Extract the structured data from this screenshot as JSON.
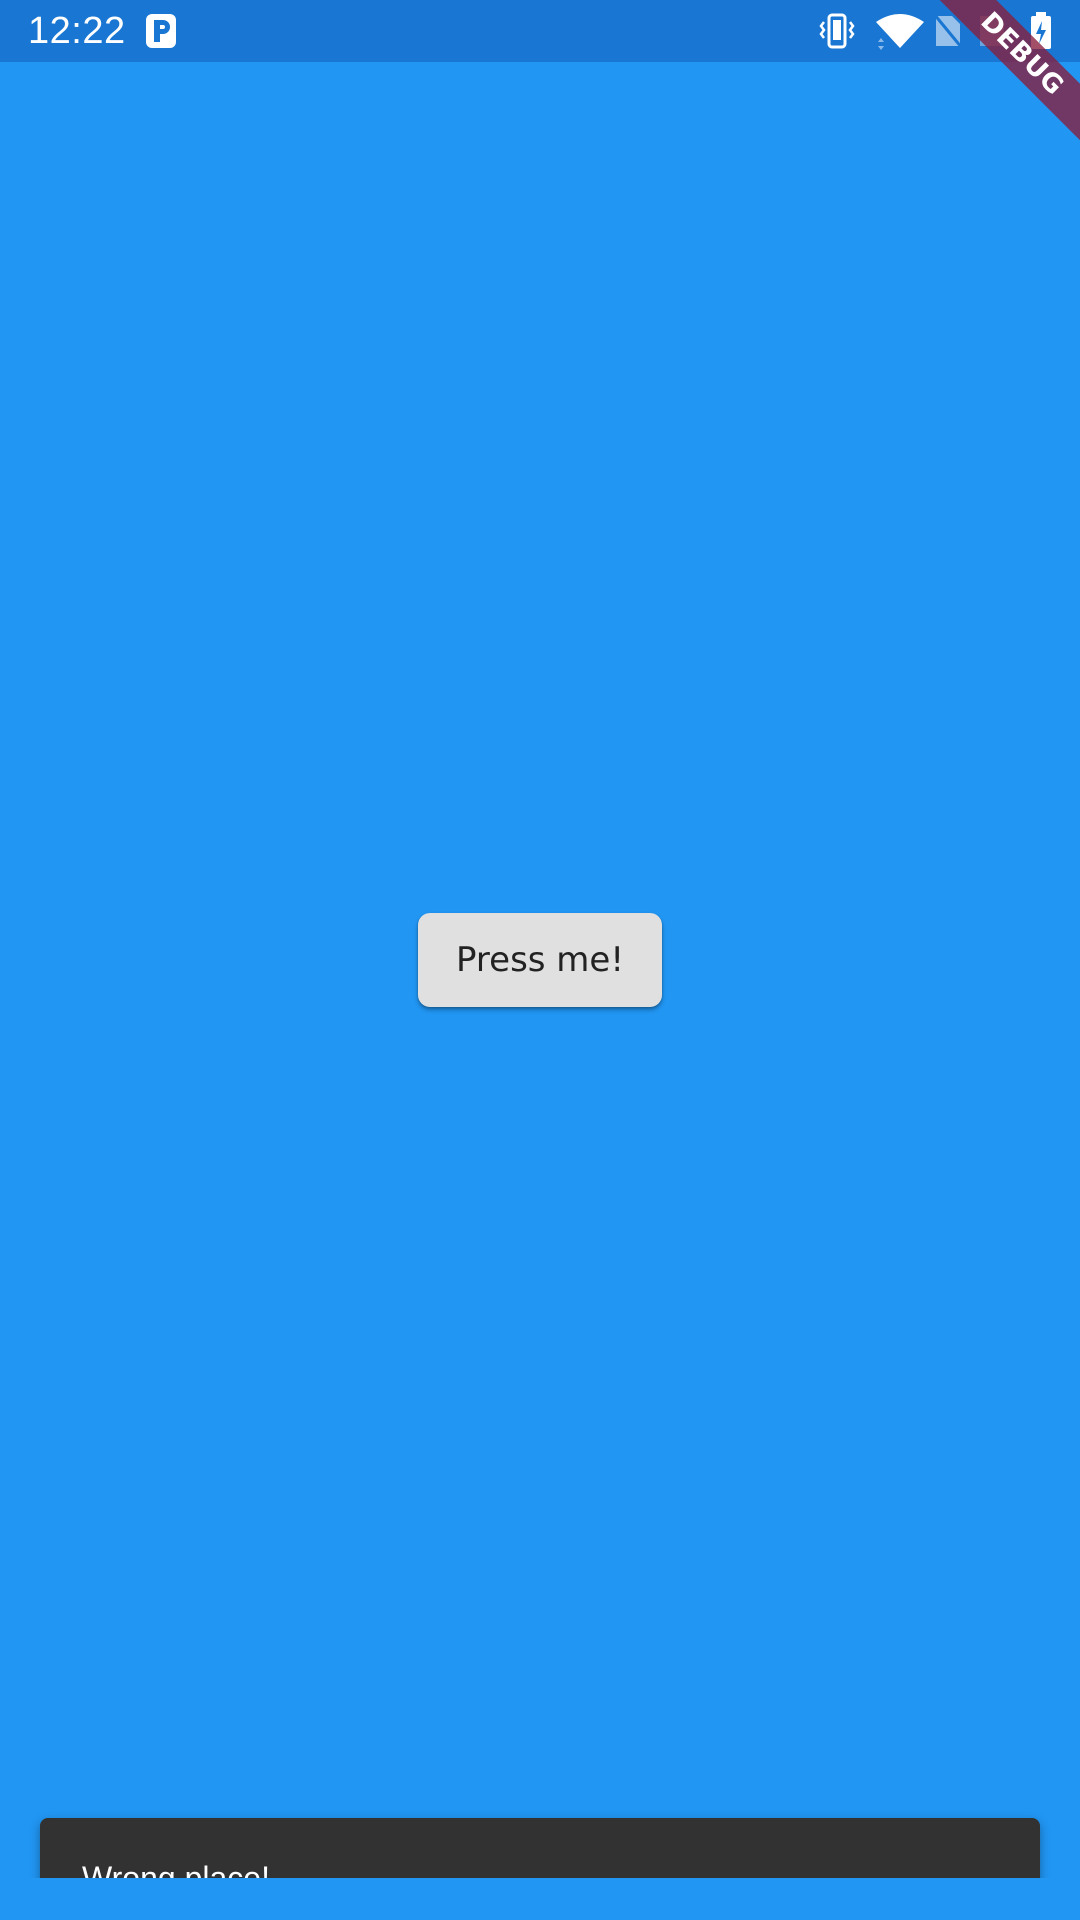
{
  "status_bar": {
    "time": "12:22",
    "app_icon": "parking-p-icon",
    "icons": [
      "vibrate-icon",
      "wifi-icon",
      "no-sim-icon",
      "sim-icon",
      "battery-charging-icon"
    ],
    "background_color": "#1976d2"
  },
  "debug_banner": {
    "label": "DEBUG",
    "color": "#881e3c"
  },
  "main": {
    "background_color": "#2196f3",
    "button_label": "Press me!"
  },
  "snackbar": {
    "message": "Wrong place!",
    "background_color": "#323232"
  }
}
